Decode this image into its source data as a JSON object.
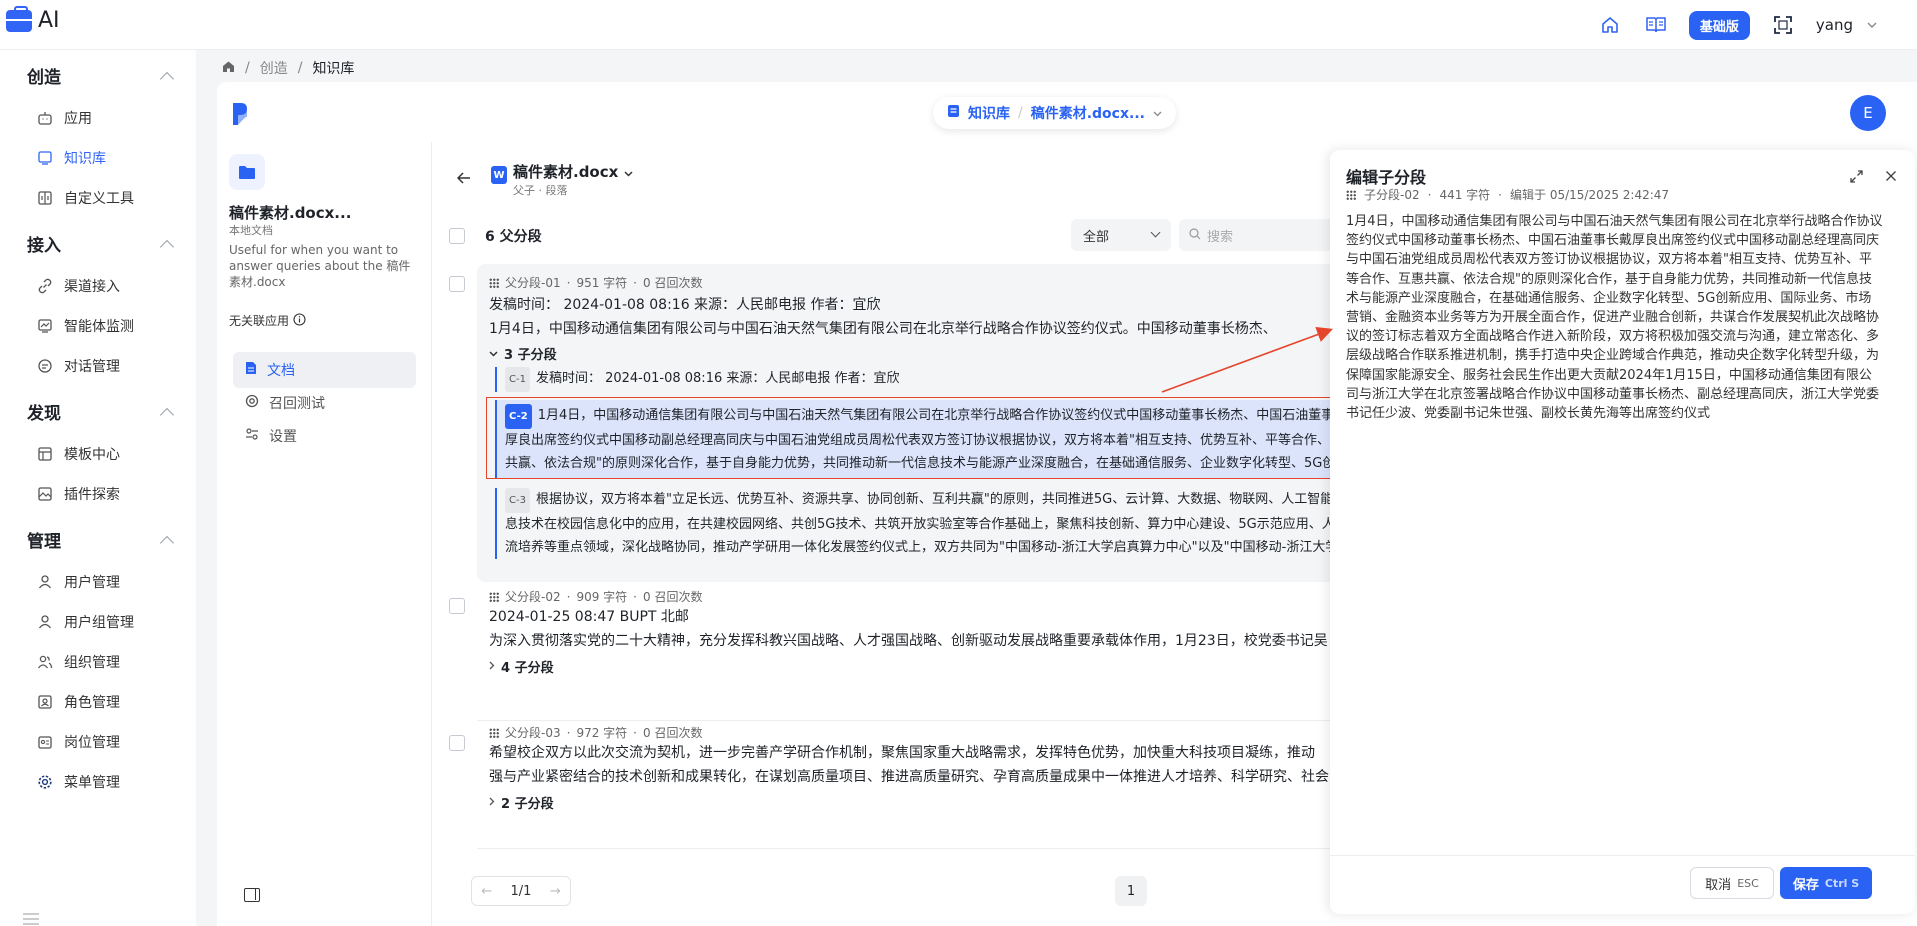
{
  "app": {
    "logo_text": "AI"
  },
  "topbar": {
    "plan_badge": "基础版",
    "username": "yang"
  },
  "nav": {
    "groups": [
      {
        "title": "创造",
        "items": [
          "应用",
          "知识库",
          "自定义工具"
        ]
      },
      {
        "title": "接入",
        "items": [
          "渠道接入",
          "智能体监测",
          "对话管理"
        ]
      },
      {
        "title": "发现",
        "items": [
          "模板中心",
          "插件探索"
        ]
      },
      {
        "title": "管理",
        "items": [
          "用户管理",
          "用户组管理",
          "组织管理",
          "角色管理",
          "岗位管理",
          "菜单管理"
        ]
      }
    ]
  },
  "breadcrumb": {
    "sep": "/",
    "level1": "创造",
    "level2": "知识库"
  },
  "kb_switcher": {
    "kb": "知识库",
    "doc": "稿件素材.docx..."
  },
  "avatar_letter": "E",
  "doc_panel": {
    "name": "稿件素材.docx...",
    "source": "本地文档",
    "description": "Useful for when you want to answer queries about the 稿件素材.docx",
    "no_linked_app": "无关联应用",
    "menu": [
      "文档",
      "召回测试",
      "设置"
    ]
  },
  "chunks": {
    "file_title": "稿件素材.docx",
    "file_sub": "父子 · 段落",
    "parent_count": "6 父分段",
    "filter_value": "全部",
    "search_placeholder": "搜索",
    "parents": [
      {
        "id": "父分段-01",
        "chars": "951 字符",
        "recalls": "0 召回次数",
        "line1": "发稿时间： 2024-01-08 08:16 来源：人民邮电报 作者：宜欣",
        "line2": "1月4日，中国移动通信集团有限公司与中国石油天然气集团有限公司在北京举行战略合作协议签约仪式。中国移动董事长杨杰、",
        "sub_toggle": "3 子分段",
        "children": [
          {
            "tag": "C-1",
            "lines": [
              "发稿时间： 2024-01-08 08:16 来源：人民邮电报 作者：宜欣"
            ]
          },
          {
            "tag": "C-2",
            "lines": [
              "1月4日，中国移动通信集团有限公司与中国石油天然气集团有限公司在北京举行战略合作协议签约仪式中国移动董事长杨杰、中国石油董事长戴",
              "厚良出席签约仪式中国移动副总经理高同庆与中国石油党组成员周松代表双方签订协议根据协议，双方将本着\"相互支持、优势互补、平等合作、互惠",
              "共赢、依法合规\"的原则深化合作，基于自身能力优势，共同推动新一代信息技术与能源产业深度融合，在基础通信服务、企业数字化转型、5G创新"
            ]
          },
          {
            "tag": "C-3",
            "lines": [
              "根据协议，双方将本着\"立足长远、优势互补、资源共享、协同创新、互利共赢\"的原则，共同推进5G、云计算、大数据、物联网、人工智能等新一代信",
              "息技术在校园信息化中的应用，在共建校园网络、共创5G技术、共筑开放实验室等合作基础上，聚焦科技创新、算力中心建设、5G示范应用、人才交",
              "流培养等重点领域，深化战略协同，推动产学研用一体化发展签约仪式上，双方共同为\"中国移动-浙江大学启真算力中心\"以及\"中国移动-浙江大学"
            ]
          }
        ]
      },
      {
        "id": "父分段-02",
        "chars": "909 字符",
        "recalls": "0 召回次数",
        "line1": "2024-01-25 08:47 BUPT 北邮",
        "line2": "为深入贯彻落实党的二十大精神，充分发挥科教兴国战略、人才强国战略、创新驱动发展战略重要承载体作用，1月23日，校党委书记吴",
        "sub_toggle": "4 子分段"
      },
      {
        "id": "父分段-03",
        "chars": "972 字符",
        "recalls": "0 召回次数",
        "line1": "希望校企双方以此次交流为契机，进一步完善产学研合作机制，聚焦国家重大战略需求，发挥特色优势，加快重大科技项目凝练，推动",
        "line2": "强与产业紧密结合的技术创新和成果转化，在谋划高质量项目、推进高质量研究、孕育高质量成果中一体推进人才培养、科学研究、社会",
        "sub_toggle": "2 子分段"
      }
    ],
    "pager": {
      "text": "1/1",
      "current_page": "1"
    }
  },
  "edit_panel": {
    "title": "编辑子分段",
    "id": "子分段-02",
    "chars": "441 字符",
    "edited": "编辑于 05/15/2025 2:42:47",
    "body": "1月4日，中国移动通信集团有限公司与中国石油天然气集团有限公司在北京举行战略合作协议签约仪式中国移动董事长杨杰、中国石油董事长戴厚良出席签约仪式中国移动副总经理高同庆与中国石油党组成员周松代表双方签订协议根据协议，双方将本着\"相互支持、优势互补、平等合作、互惠共赢、依法合规\"的原则深化合作，基于自身能力优势，共同推动新一代信息技术与能源产业深度融合，在基础通信服务、企业数字化转型、5G创新应用、国际业务、市场营销、金融资本业务等方为开展全面合作，促进产业融合创新，共谋合作发展契机此次战略协议的签订标志着双方全面战略合作进入新阶段，双方将积极加强交流与沟通，建立常态化、多层级战略合作联系推进机制，携手打造中央企业跨域合作典范，推动央企数字化转型升级，为保障国家能源安全、服务社会民生作出更大贡献2024年1月15日，中国移动通信集团有限公司与浙江大学在北京签署战略合作协议中国移动董事长杨杰、副总经理高同庆，浙江大学党委书记任少波、党委副书记朱世强、副校长黄先海等出席签约仪式",
    "cancel_label": "取消",
    "cancel_key": "ESC",
    "save_label": "保存",
    "save_key": "Ctrl S"
  },
  "colors": {
    "accent": "#2a63f3",
    "annotation": "#e5452b"
  }
}
